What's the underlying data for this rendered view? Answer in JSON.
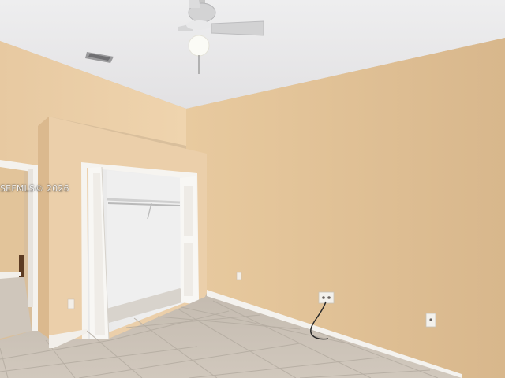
{
  "watermark": {
    "text": "SEFMLS© 2026"
  }
}
